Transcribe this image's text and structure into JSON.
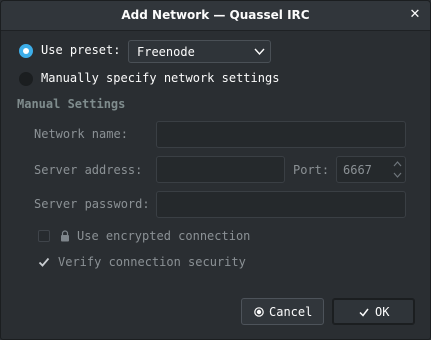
{
  "window": {
    "title": "Add Network — Quassel IRC",
    "close_icon": "close-icon"
  },
  "preset": {
    "use_preset_label": "Use preset:",
    "selected": "Freenode",
    "manual_label": "Manually specify network settings"
  },
  "manual": {
    "section_title": "Manual Settings",
    "network_name_label": "Network name:",
    "network_name_value": "",
    "server_address_label": "Server address:",
    "server_address_value": "",
    "port_label": "Port:",
    "port_value": "6667",
    "server_password_label": "Server password:",
    "server_password_value": "",
    "encrypted_label": "Use encrypted connection",
    "verify_label": "Verify connection security"
  },
  "buttons": {
    "cancel_label": "Cancel",
    "ok_label": "OK"
  },
  "colors": {
    "accent": "#3daee9",
    "background": "#2a2e32",
    "text": "#fcfcfc",
    "disabled_text": "#8b9195"
  }
}
